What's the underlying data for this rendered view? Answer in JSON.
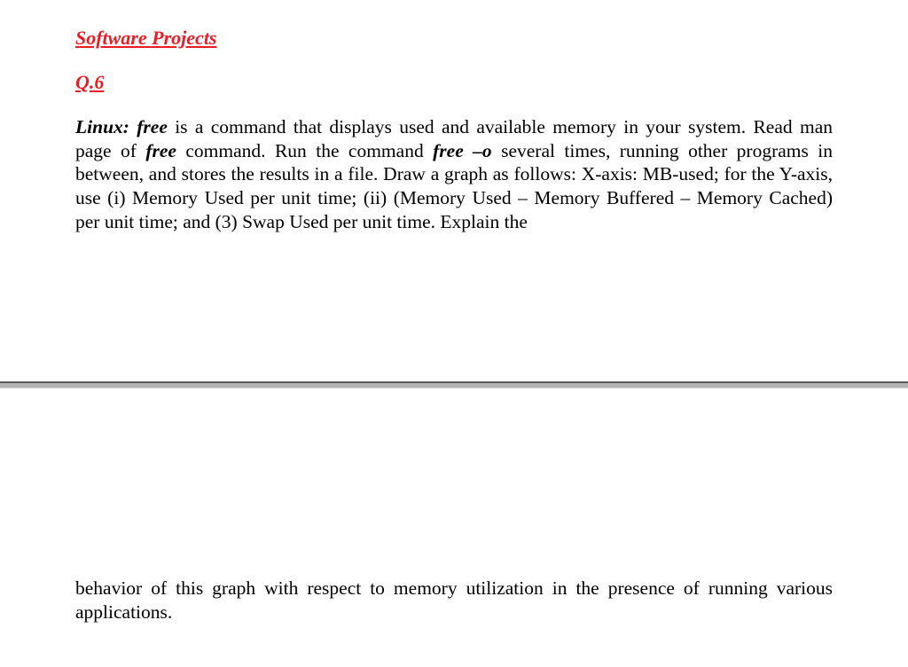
{
  "section_title": "Software Projects",
  "question_number": "Q.6",
  "body": {
    "b1": "Linux: free",
    "t1": " is a command that displays used and available memory in your system. Read man page of ",
    "b2": "free",
    "t2": " command. Run the command ",
    "b3": "free –o",
    "t3": " several times, running other programs in between, and stores the results in a file. Draw a graph as follows: X-axis: MB-used; for the Y-axis, use (i) Memory Used per unit time; (ii) (Memory Used – Memory Buffered – Memory Cached) per unit time; and (3) Swap Used per unit time. Explain the"
  },
  "lower_text": "behavior of this graph with respect to memory utilization in the presence of running various applications."
}
